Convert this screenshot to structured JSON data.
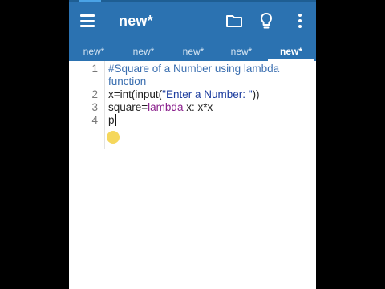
{
  "toolbar": {
    "title": "new*",
    "menu_icon": "hamburger-menu-icon",
    "folder_icon": "folder-icon",
    "lightbulb_icon": "lightbulb-icon",
    "more_icon": "more-vert-icon"
  },
  "tabs": [
    {
      "label": "new*",
      "active": false
    },
    {
      "label": "new*",
      "active": false
    },
    {
      "label": "new*",
      "active": false
    },
    {
      "label": "new*",
      "active": false
    },
    {
      "label": "new*",
      "active": true
    }
  ],
  "editor": {
    "lines": [
      {
        "number": "1",
        "text_a": "#Square of a Number using lambda",
        "text_b": "function"
      },
      {
        "number": "2",
        "pre": "x=int(input(",
        "string": "\"Enter a Number: \"",
        "post": "))"
      },
      {
        "number": "3",
        "pre": "square=",
        "keyword": "lambda",
        "post": " x: x*x"
      },
      {
        "number": "4",
        "text": "p"
      }
    ]
  },
  "colors": {
    "toolbar": "#2b72b1",
    "comment": "#3b6fb0",
    "keyword": "#8a1f8c",
    "string": "#1c3c9e"
  }
}
